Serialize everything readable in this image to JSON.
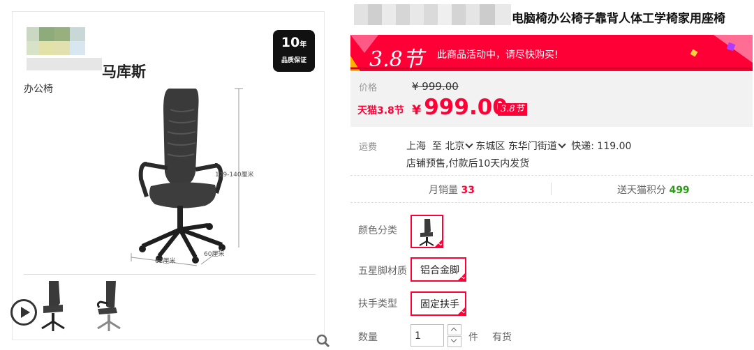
{
  "left": {
    "brand_name": "马库斯",
    "brand_sub": "办公椅",
    "warranty": {
      "years": "10",
      "unit": "年",
      "label": "品质保证"
    },
    "dimensions": {
      "height": "129-140厘米",
      "width": "62厘米",
      "depth": "60厘米"
    },
    "icons": {
      "play": "play-icon",
      "zoom": "search-icon"
    }
  },
  "product": {
    "title": "电脑椅办公椅子靠背人体工学椅家用座椅"
  },
  "promo": {
    "logo": "3.8节",
    "text": "此商品活动中，请尽快购买!"
  },
  "price": {
    "label": "价格",
    "original": "¥ 999.00",
    "tmall_label": "天猫3.8节",
    "currency": "¥",
    "current": "999.00",
    "badge": "3.8节"
  },
  "shipping": {
    "label": "运费",
    "from": "上海",
    "to_word": "至",
    "city": "北京",
    "district": "东城区",
    "street": "东华门街道",
    "express": "快递: 119.00",
    "note": "店铺预售,付款后10天内发货"
  },
  "stats": {
    "sales_label": "月销量",
    "sales_value": "33",
    "points_label": "送天猫积分",
    "points_value": "499"
  },
  "options": {
    "color_label": "颜色分类",
    "leg_label": "五星脚材质",
    "leg_value": "铝合金脚",
    "arm_label": "扶手类型",
    "arm_value": "固定扶手"
  },
  "quantity": {
    "label": "数量",
    "value": "1",
    "unit": "件",
    "stock": "有货"
  },
  "colors": {
    "accent": "#ff0036",
    "points": "#2b9c16",
    "price_bg": "#f2f2f2"
  }
}
